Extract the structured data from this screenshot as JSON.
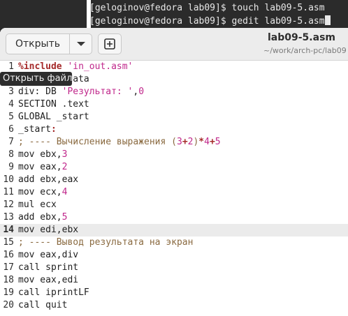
{
  "terminal": {
    "lines": [
      "[geloginov@fedora lab09]$ touch lab09-5.asm",
      "[geloginov@fedora lab09]$ gedit lab09-5.asm"
    ]
  },
  "header": {
    "open_label": "Открыть",
    "title": "lab09-5.asm",
    "subtitle": "~/work/arch-pc/lab09"
  },
  "tooltip": "Открыть файл",
  "code": {
    "current_line": 14,
    "lines": [
      {
        "n": "1",
        "text": "%include 'in_out.asm'"
      },
      {
        "n": "2",
        "text": "SECTION .data"
      },
      {
        "n": "3",
        "text": "div: DB 'Результат: ',0"
      },
      {
        "n": "4",
        "text": "SECTION .text"
      },
      {
        "n": "5",
        "text": "GLOBAL _start"
      },
      {
        "n": "6",
        "text": "_start:"
      },
      {
        "n": "7",
        "text": "; ---- Вычисление выражения (3+2)*4+5"
      },
      {
        "n": "8",
        "text": "mov ebx,3"
      },
      {
        "n": "9",
        "text": "mov eax,2"
      },
      {
        "n": "10",
        "text": "add ebx,eax"
      },
      {
        "n": "11",
        "text": "mov ecx,4"
      },
      {
        "n": "12",
        "text": "mul ecx"
      },
      {
        "n": "13",
        "text": "add ebx,5"
      },
      {
        "n": "14",
        "text": "mov edi,ebx"
      },
      {
        "n": "15",
        "text": "; ---- Вывод результата на экран"
      },
      {
        "n": "16",
        "text": "mov eax,div"
      },
      {
        "n": "17",
        "text": "call sprint"
      },
      {
        "n": "18",
        "text": "mov eax,edi"
      },
      {
        "n": "19",
        "text": "call iprintLF"
      },
      {
        "n": "20",
        "text": "call quit"
      }
    ]
  }
}
